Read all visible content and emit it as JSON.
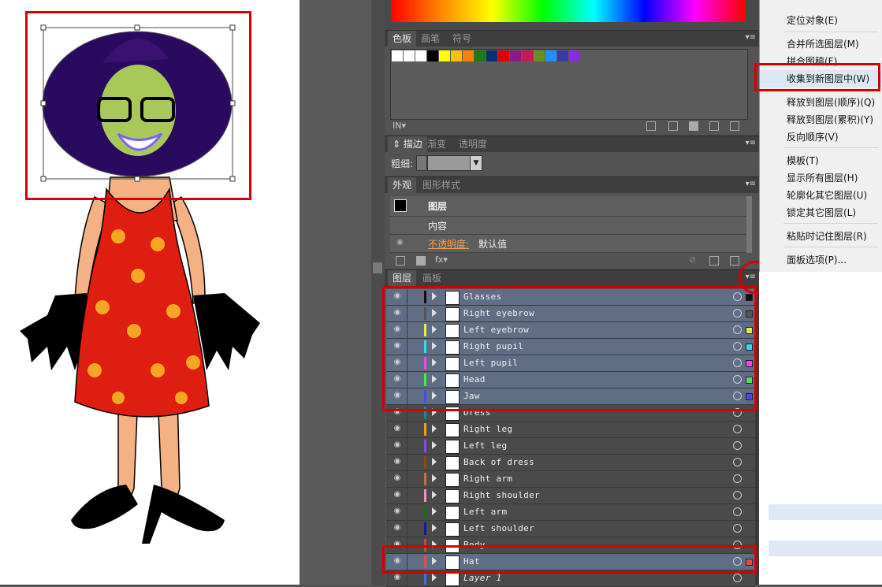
{
  "swatch_panel": {
    "tabs": [
      "色板",
      "画笔",
      "符号"
    ],
    "swatch_colors": [
      "#ffffff",
      "#ffffff",
      "#ffffff",
      "#000000",
      "#ffff00",
      "#ffc000",
      "#ff7f00",
      "#1a7a1a",
      "#0a3070",
      "#e00000",
      "#8a1a8a",
      "#c31a5a",
      "#6b8e23",
      "#1e90ff",
      "#3a3aa0",
      "#8a2be2"
    ]
  },
  "stroke_panel": {
    "tabs": [
      "描边",
      "渐变",
      "透明度"
    ],
    "weight_label": "粗细:"
  },
  "appearance_panel": {
    "tabs": [
      "外观",
      "图形样式"
    ],
    "rows": [
      "图层",
      "内容"
    ],
    "opacity_label": "不透明度:",
    "opacity_value": "默认值"
  },
  "layers_panel": {
    "tabs": [
      "图层",
      "画板"
    ],
    "layers": [
      {
        "name": "Glasses",
        "color": "#111111",
        "selected": true
      },
      {
        "name": "Right eyebrow",
        "color": "#555555",
        "selected": true
      },
      {
        "name": "Left eyebrow",
        "color": "#e8e84a",
        "selected": true
      },
      {
        "name": "Right pupil",
        "color": "#3ad8e8",
        "selected": true
      },
      {
        "name": "Left pupil",
        "color": "#e84ae8",
        "selected": true
      },
      {
        "name": "Head",
        "color": "#4ae84a",
        "selected": true
      },
      {
        "name": "Jaw",
        "color": "#4a4ae8",
        "selected": true
      },
      {
        "name": "Dress",
        "color": "#1a8a8a",
        "selected": false
      },
      {
        "name": "Right leg",
        "color": "#e8a020",
        "selected": false
      },
      {
        "name": "Left leg",
        "color": "#8a4ae8",
        "selected": false
      },
      {
        "name": "Back of dress",
        "color": "#8a4a20",
        "selected": false
      },
      {
        "name": "Right arm",
        "color": "#c07040",
        "selected": false
      },
      {
        "name": "Right shoulder",
        "color": "#e890c0",
        "selected": false
      },
      {
        "name": "Left arm",
        "color": "#1a6a1a",
        "selected": false
      },
      {
        "name": "Left shoulder",
        "color": "#1a1a8a",
        "selected": false
      },
      {
        "name": "Body",
        "color": "#c04a4a",
        "selected": false
      },
      {
        "name": "Hat",
        "color": "#e84a4a",
        "selected": true
      },
      {
        "name": "Layer 1",
        "color": "#4a6ae8",
        "selected": false
      }
    ]
  },
  "context_menu": {
    "items": [
      {
        "label": "定位对象(E)",
        "highlight": false
      },
      {
        "label": "合并所选图层(M)",
        "highlight": false
      },
      {
        "label": "拼合图稿(F)",
        "highlight": false
      },
      {
        "label": "收集到新图层中(W)",
        "highlight": true
      },
      {
        "label": "释放到图层(顺序)(Q)",
        "highlight": false
      },
      {
        "label": "释放到图层(累积)(Y)",
        "highlight": false
      },
      {
        "label": "反向顺序(V)",
        "highlight": false
      },
      {
        "label": "模板(T)",
        "highlight": false
      },
      {
        "label": "显示所有图层(H)",
        "highlight": false
      },
      {
        "label": "轮廓化其它图层(U)",
        "highlight": false
      },
      {
        "label": "锁定其它图层(L)",
        "highlight": false
      },
      {
        "label": "粘贴时记住图层(R)",
        "highlight": false
      },
      {
        "label": "面板选项(P)...",
        "highlight": false
      }
    ]
  },
  "colors": {
    "highlight_box": "#d40000",
    "selected_row": "#606e85"
  }
}
